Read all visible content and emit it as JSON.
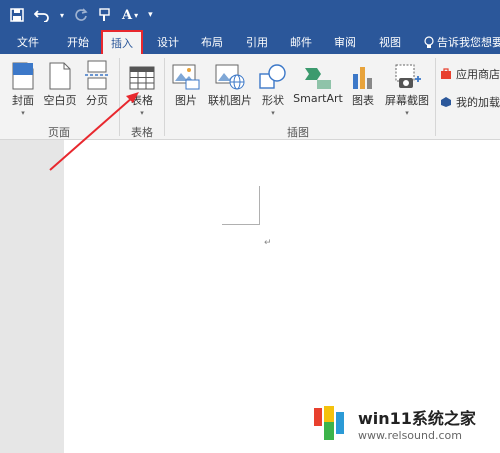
{
  "qat": {
    "save_icon": "save-icon",
    "undo_icon": "undo-icon",
    "redo_icon": "redo-icon",
    "format_painter_icon": "format-painter-icon",
    "font_icon_label": "A",
    "customize_icon": "customize-qat-icon"
  },
  "tabs": [
    {
      "label": "文件"
    },
    {
      "label": "开始"
    },
    {
      "label": "插入"
    },
    {
      "label": "设计"
    },
    {
      "label": "布局"
    },
    {
      "label": "引用"
    },
    {
      "label": "邮件"
    },
    {
      "label": "审阅"
    },
    {
      "label": "视图"
    }
  ],
  "tell_me": "告诉我您想要",
  "ribbon": {
    "pages_group": {
      "label": "页面",
      "buttons": [
        {
          "label": "封面",
          "dropdown": "▾"
        },
        {
          "label": "空白页"
        },
        {
          "label": "分页"
        }
      ]
    },
    "tables_group": {
      "label": "表格",
      "buttons": [
        {
          "label": "表格",
          "dropdown": "▾"
        }
      ]
    },
    "illustrations_group": {
      "label": "插图",
      "buttons": [
        {
          "label": "图片"
        },
        {
          "label": "联机图片"
        },
        {
          "label": "形状",
          "dropdown": "▾"
        },
        {
          "label": "SmartArt"
        },
        {
          "label": "图表"
        },
        {
          "label": "屏幕截图",
          "dropdown": "▾"
        }
      ]
    },
    "addins": {
      "store": "应用商店",
      "my_addins": "我的加载项"
    }
  },
  "document": {
    "paragraph_mark": "↵"
  },
  "watermark": {
    "title": "win11系统之家",
    "url": "www.relsound.com"
  },
  "colors": {
    "title_bar": "#2b579a",
    "ribbon_bg": "#f3f3f3",
    "highlight_red": "#e8282e"
  }
}
